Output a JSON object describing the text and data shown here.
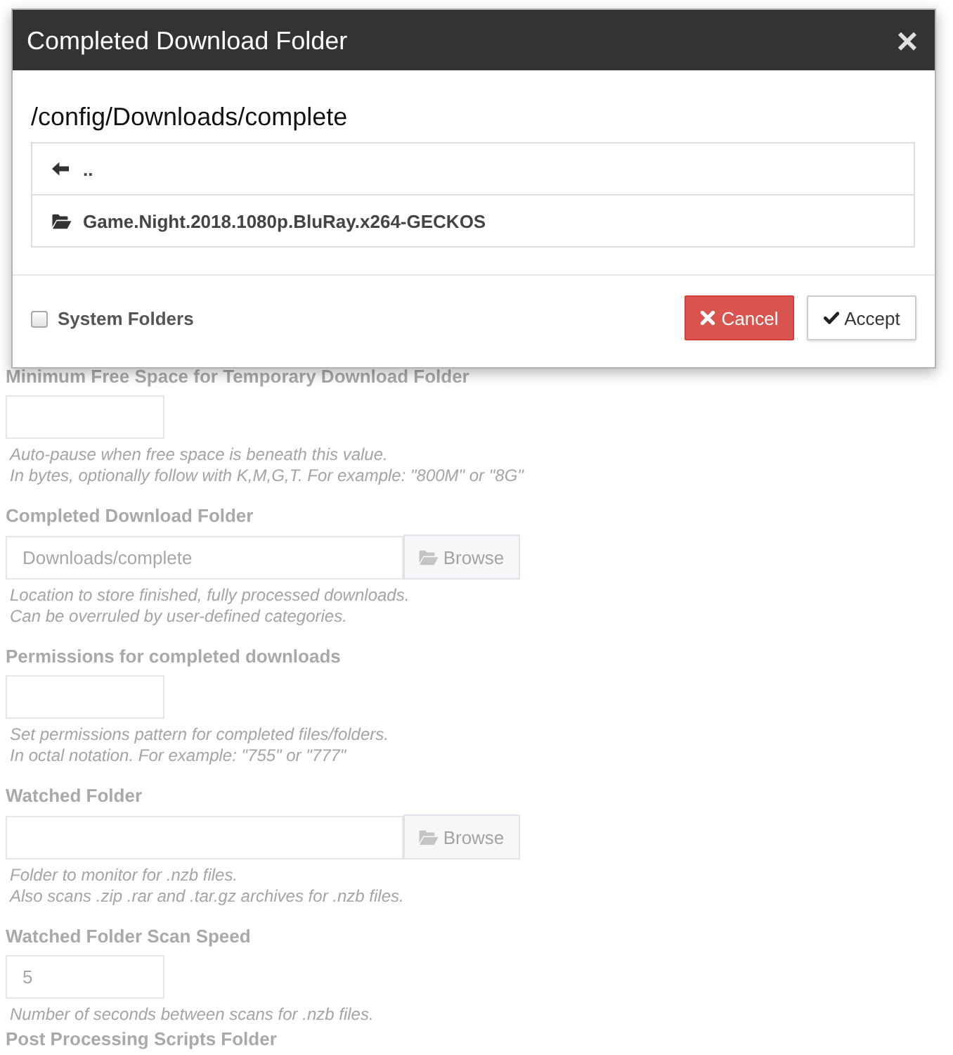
{
  "dialog": {
    "title": "Completed Download Folder",
    "close": "×",
    "path": "/config/Downloads/complete",
    "entries": [
      {
        "kind": "parent",
        "name": ".."
      },
      {
        "kind": "folder",
        "name": "Game.Night.2018.1080p.BluRay.x264-GECKOS"
      }
    ],
    "system_folders": {
      "label": "System Folders",
      "checked": false
    },
    "buttons": [
      {
        "kind": "cancel",
        "label": "Cancel"
      },
      {
        "kind": "accept",
        "label": "Accept"
      }
    ]
  },
  "settings": [
    {
      "kind": "short",
      "label": "Minimum Free Space for Temporary Download Folder",
      "hints": [
        "Auto-pause when free space is beneath this value.",
        "In bytes, optionally follow with K,M,G,T. For example: \"800M\" or \"8G\""
      ]
    },
    {
      "kind": "folder",
      "label": "Completed Download Folder",
      "value": "Downloads/complete",
      "browse": "Browse",
      "hints": [
        "Location to store finished, fully processed downloads.",
        "Can be overruled by user-defined categories."
      ]
    },
    {
      "kind": "short",
      "label": "Permissions for completed downloads",
      "hints": [
        "Set permissions pattern for completed files/folders.",
        "In octal notation. For example: \"755\" or \"777\""
      ]
    },
    {
      "kind": "folder",
      "label": "Watched Folder",
      "browse": "Browse",
      "hints": [
        "Folder to monitor for .nzb files.",
        "Also scans .zip .rar and .tar.gz archives for .nzb files."
      ]
    },
    {
      "kind": "short",
      "label": "Watched Folder Scan Speed",
      "value": "5",
      "hints": [
        "Number of seconds between scans for .nzb files."
      ]
    },
    {
      "kind": "label",
      "label": "Post Processing Scripts Folder"
    }
  ]
}
